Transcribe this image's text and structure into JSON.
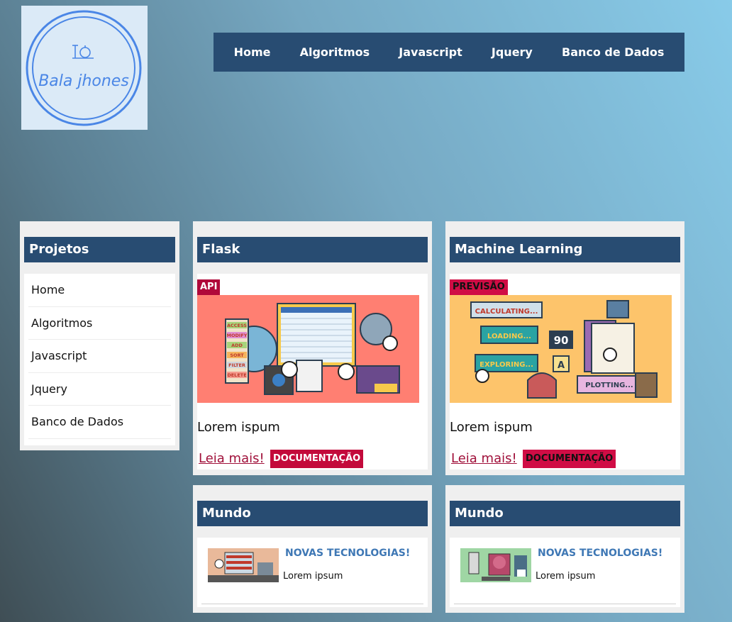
{
  "logo": {
    "text": "Bala jhones"
  },
  "nav": [
    "Home",
    "Algoritmos",
    "Javascript",
    "Jquery",
    "Banco de Dados"
  ],
  "sidebar": {
    "title": "Projetos",
    "items": [
      "Home",
      "Algoritmos",
      "Javascript",
      "Jquery",
      "Banco de Dados"
    ]
  },
  "cards": [
    {
      "title": "Flask",
      "tag": "API",
      "text": "Lorem ispum",
      "read_more": "Leia mais!",
      "doc": "DOCUMENTAÇÃO"
    },
    {
      "title": "Machine Learning",
      "tag": "PREVISÃO",
      "text": "Lorem ispum",
      "read_more": "Leia mais!",
      "doc": "DOCUMENTAÇÃO"
    }
  ],
  "news": [
    {
      "title": "Mundo",
      "headline": "NOVAS TECNOLOGIAS!",
      "text": "Lorem ipsum"
    },
    {
      "title": "Mundo",
      "headline": "NOVAS TECNOLOGIAS!",
      "text": "Lorem ipsum"
    }
  ],
  "illustration_labels": {
    "flask": [
      "ACCESS",
      "MODIFY",
      "ADD",
      "SORT",
      "FILTER",
      "DELETE"
    ],
    "ml": [
      "CALCULATING...",
      "LOADING...",
      "EXPLORING...",
      "PLOTTING...",
      "90",
      "A"
    ]
  },
  "colors": {
    "nav_bg": "#284c72",
    "accent": "#c30a3b",
    "news_head": "#3f78b5"
  }
}
